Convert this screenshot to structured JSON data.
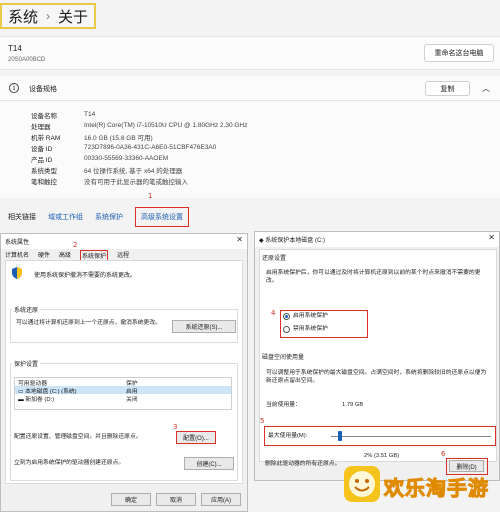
{
  "settings": {
    "breadcrumb": {
      "parent": "系统",
      "separator": "›",
      "current": "关于"
    },
    "device": {
      "name": "T14",
      "model": "20S0A00BCD",
      "rename_button": "重命名这台电脑"
    },
    "specs": {
      "title": "设备规格",
      "copy_button": "复制",
      "rows": [
        {
          "key": "设备名称",
          "value": "T14"
        },
        {
          "key": "处理器",
          "value": "Intel(R) Core(TM) i7-10510U CPU @ 1.80GHz   2.30 GHz"
        },
        {
          "key": "机带 RAM",
          "value": "16.0 GB (15.8 GB 可用)"
        },
        {
          "key": "设备 ID",
          "value": "723D7896-0A36-431C-A6E0-51CBF476E3A0"
        },
        {
          "key": "产品 ID",
          "value": "00330-55569-33360-AAOEM"
        },
        {
          "key": "系统类型",
          "value": "64 位操作系统, 基于 x64 的处理器"
        },
        {
          "key": "笔和触控",
          "value": "没有可用于此显示器的笔或触控输入"
        }
      ]
    },
    "related_links": {
      "label": "相关链接",
      "links": [
        "域或工作组",
        "系统保护",
        "高级系统设置"
      ]
    }
  },
  "step_numbers": [
    "1",
    "2",
    "3",
    "4",
    "5",
    "6"
  ],
  "system_properties": {
    "title": "系统属性",
    "tabs": [
      "计算机名",
      "硬件",
      "高级",
      "系统保护",
      "远程"
    ],
    "intro": "使用系统保护撤消不需要的系统更改。",
    "restore_group": {
      "title": "系统还原",
      "text": "可以通过将计算机还原到上一个还原点，撤消系统更改。",
      "button": "系统还原(S)..."
    },
    "protection_group": {
      "title": "保护设置",
      "columns": [
        "可用驱动器",
        "保护"
      ],
      "drives": [
        {
          "name": "本地磁盘 (C:) (系统)",
          "status": "启用"
        },
        {
          "name": "新加卷 (D:)",
          "status": "关闭"
        }
      ],
      "configure_text": "配置还原设置、管理磁盘空间，并且删除还原点。",
      "configure_button": "配置(O)...",
      "create_text": "立刻为启用系统保护的驱动器创建还原点。",
      "create_button": "创建(C)..."
    },
    "bottom_buttons": [
      "确定",
      "取消",
      "应用(A)"
    ]
  },
  "protect_dialog": {
    "title": "系统保护本地磁盘 (C:)",
    "restore_settings": {
      "title": "还原设置",
      "text": "启用系统保护后，你可以通过及时将计算机还原到以前的某个时点来撤消不需要的更改。",
      "radio_on": "启用系统保护",
      "radio_off": "禁用系统保护"
    },
    "disk_usage": {
      "title": "磁盘空间使用量",
      "text": "可以调整用于系统保护的最大磁盘空间。占满空间时，系统将删除较旧的还原点以便为新还原点留出空间。",
      "current_label": "当前使用量：",
      "current_value": "1.79 GB",
      "max_label": "最大使用量(M):",
      "max_percent": 0.02,
      "max_value_text": "2% (3.51 GB)",
      "delete_text": "删除此驱动器的所有还原点。",
      "delete_button": "删除(D)"
    }
  },
  "watermark": {
    "text": "欢乐淘手游"
  },
  "colors": {
    "highlight": "#d93025",
    "link": "#1a5fb4",
    "breadcrumb_box": "#e8c94a",
    "watermark": "#f6c21c"
  }
}
